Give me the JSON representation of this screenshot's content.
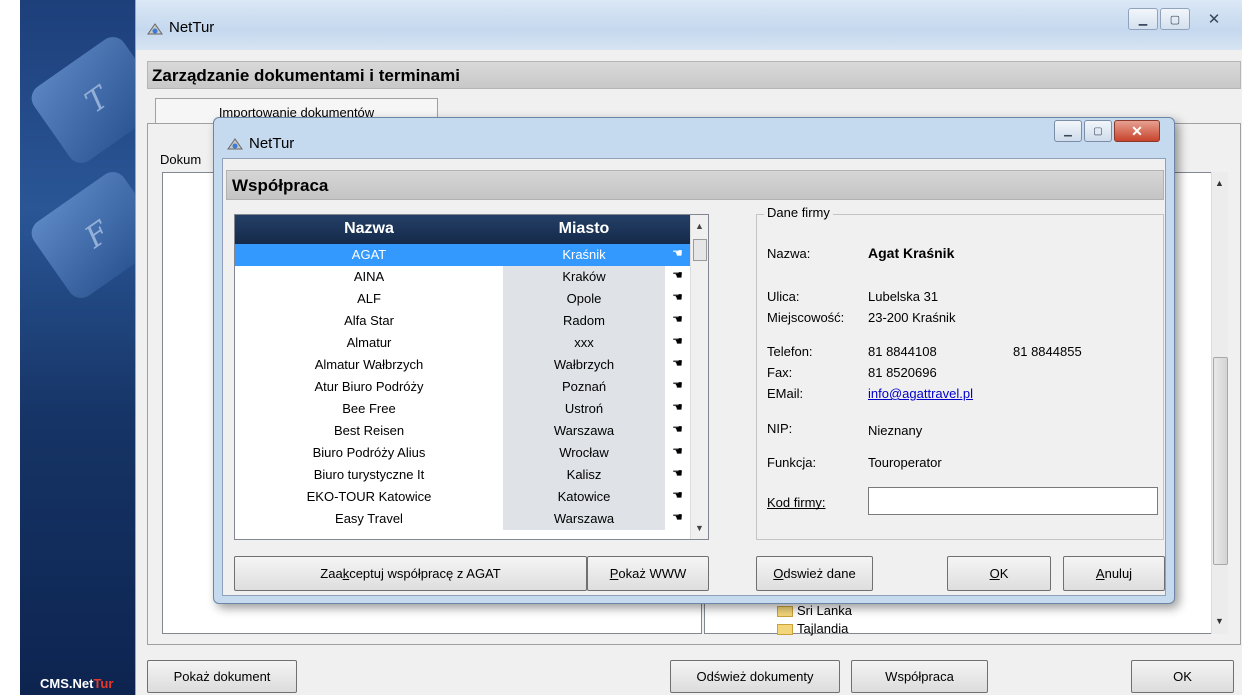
{
  "branding": {
    "prefix": "CMS.Net",
    "suffix": "Tur"
  },
  "main_window": {
    "title": "NetTur",
    "header": "Zarządzanie dokumentami i terminami",
    "tab": "Importowanie dokumentów",
    "doc_label": "Dokum",
    "tree_items": [
      "Sri Lanka",
      "Tajlandia"
    ],
    "buttons": {
      "show_doc": "Pokaż dokument",
      "refresh_docs": "Odśwież dokumenty",
      "cooperation": "Współpraca",
      "ok": "OK"
    }
  },
  "dialog": {
    "title": "NetTur",
    "header": "Współpraca",
    "grid": {
      "columns": [
        "Nazwa",
        "Miasto"
      ],
      "selected_index": 0,
      "rows": [
        {
          "name": "AGAT",
          "city": "Kraśnik"
        },
        {
          "name": "AINA",
          "city": "Kraków"
        },
        {
          "name": "ALF",
          "city": "Opole"
        },
        {
          "name": "Alfa Star",
          "city": "Radom"
        },
        {
          "name": "Almatur",
          "city": "xxx"
        },
        {
          "name": "Almatur Wałbrzych",
          "city": "Wałbrzych"
        },
        {
          "name": "Atur Biuro Podróży",
          "city": "Poznań"
        },
        {
          "name": "Bee Free",
          "city": "Ustroń"
        },
        {
          "name": "Best Reisen",
          "city": "Warszawa"
        },
        {
          "name": "Biuro Podróży Alius",
          "city": "Wrocław"
        },
        {
          "name": "Biuro turystyczne It",
          "city": "Kalisz"
        },
        {
          "name": "EKO-TOUR Katowice",
          "city": "Katowice"
        },
        {
          "name": "Easy Travel",
          "city": "Warszawa"
        }
      ]
    },
    "company": {
      "group_title": "Dane firmy",
      "name_label": "Nazwa:",
      "name_value": "Agat Kraśnik",
      "street_label": "Ulica:",
      "street_value": "Lubelska 31",
      "city_label": "Miejscowość:",
      "city_value": "23-200  Kraśnik",
      "phone_label": "Telefon:",
      "phone_value": "81  8844108",
      "phone2_value": "81  8844855",
      "fax_label": "Fax:",
      "fax_value": "81  8520696",
      "email_label": "EMail:",
      "email_value": "info@agattravel.pl",
      "nip_label": "NIP:",
      "nip_value": "Nieznany",
      "function_label": "Funkcja:",
      "function_value": "Touroperator",
      "code_label": "Kod firmy:",
      "code_value": ""
    },
    "buttons": {
      "accept_pre": "Zaa",
      "accept_key": "k",
      "accept_post": "ceptuj współpracę z AGAT",
      "www_key": "P",
      "www_post": "okaż WWW",
      "refresh_key": "O",
      "refresh_post": "dswież dane",
      "ok_key": "O",
      "ok_post": "K",
      "cancel_key": "A",
      "cancel_post": "nuluj"
    }
  }
}
